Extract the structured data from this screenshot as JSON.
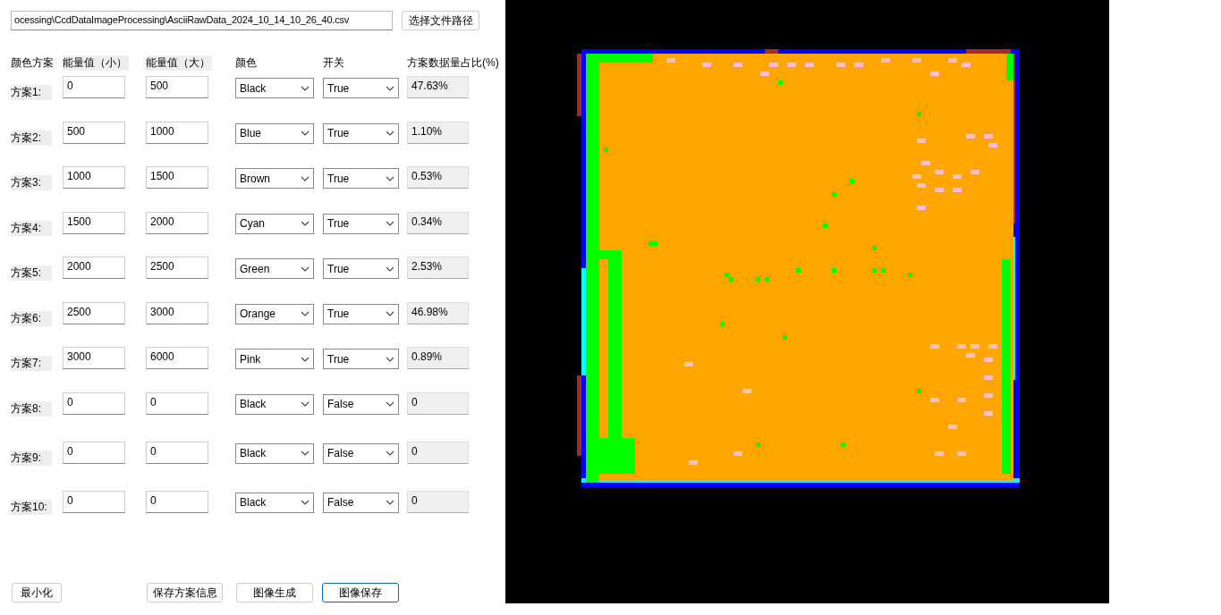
{
  "file_path": {
    "value": "ocessing\\CcdDataImageProcessing\\AsciiRawData_2024_10_14_10_26_40.csv"
  },
  "browse_button": "选择文件路径",
  "headers": [
    "颜色方案",
    "能量值（小）",
    "能量值（大）",
    "颜色",
    "开关",
    "方案数据量占比(%)"
  ],
  "schemes": [
    {
      "label": "方案1:",
      "min": "0",
      "max": "500",
      "color_name": "Black",
      "switch": "True",
      "ratio": "47.63%"
    },
    {
      "label": "方案2:",
      "min": "500",
      "max": "1000",
      "color_name": "Blue",
      "switch": "True",
      "ratio": "1.10%"
    },
    {
      "label": "方案3:",
      "min": "1000",
      "max": "1500",
      "color_name": "Brown",
      "switch": "True",
      "ratio": "0.53%"
    },
    {
      "label": "方案4:",
      "min": "1500",
      "max": "2000",
      "color_name": "Cyan",
      "switch": "True",
      "ratio": "0.34%"
    },
    {
      "label": "方案5:",
      "min": "2000",
      "max": "2500",
      "color_name": "Green",
      "switch": "True",
      "ratio": "2.53%"
    },
    {
      "label": "方案6:",
      "min": "2500",
      "max": "3000",
      "color_name": "Orange",
      "switch": "True",
      "ratio": "46.98%"
    },
    {
      "label": "方案7:",
      "min": "3000",
      "max": "6000",
      "color_name": "Pink",
      "switch": "True",
      "ratio": "0.89%"
    },
    {
      "label": "方案8:",
      "min": "0",
      "max": "0",
      "color_name": "Black",
      "switch": "False",
      "ratio": "0"
    },
    {
      "label": "方案9:",
      "min": "0",
      "max": "0",
      "color_name": "Black",
      "switch": "False",
      "ratio": "0"
    },
    {
      "label": "方案10:",
      "min": "0",
      "max": "0",
      "color_name": "Black",
      "switch": "False",
      "ratio": "0"
    }
  ],
  "buttons": [
    {
      "label": "最小化",
      "focused": false
    },
    {
      "label": "保存方案信息",
      "focused": false
    },
    {
      "label": "图像生成",
      "focused": false
    },
    {
      "label": "图像保存",
      "focused": true
    }
  ]
}
